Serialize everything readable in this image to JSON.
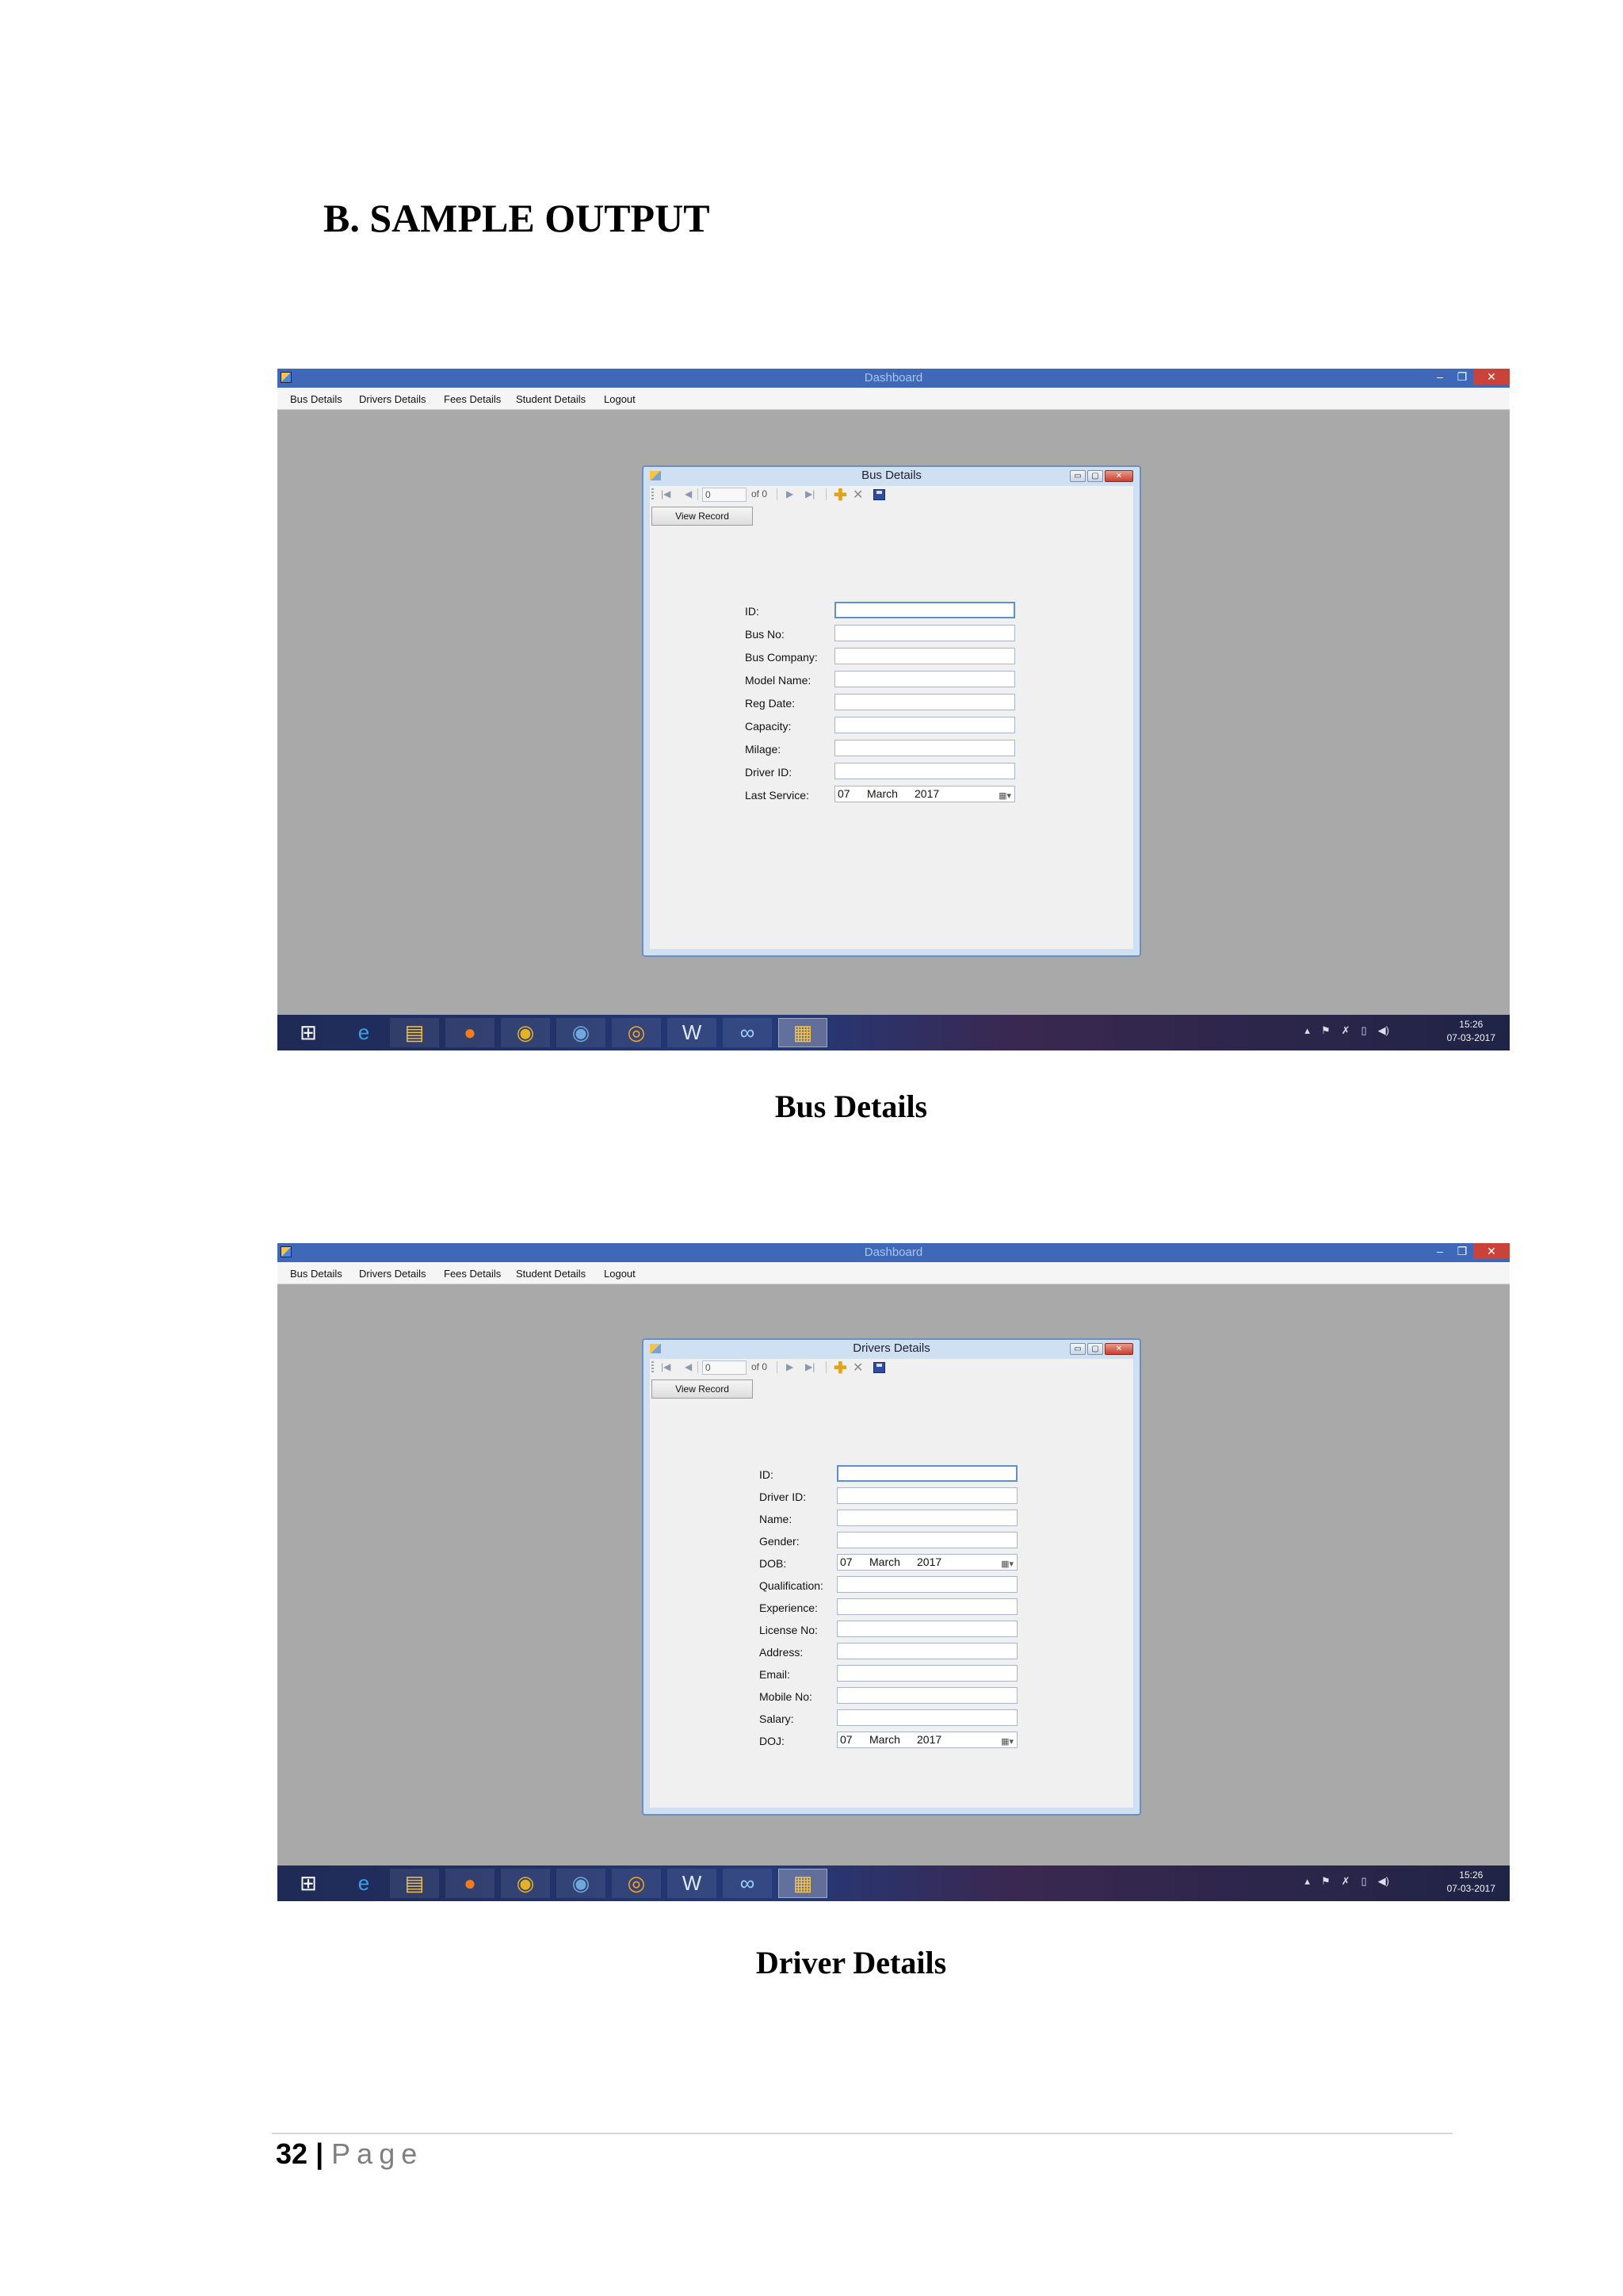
{
  "section_heading": "B. SAMPLE OUTPUT",
  "captions": {
    "bus": "Bus Details",
    "driver": "Driver Details"
  },
  "main_window": {
    "title": "Dashboard"
  },
  "menu": [
    "Bus Details",
    "Drivers Details",
    "Fees Details",
    "Student Details",
    "Logout"
  ],
  "navigator": {
    "position": "0",
    "count_label": "of 0"
  },
  "bus_form": {
    "title": "Bus Details",
    "view_button": "View Record",
    "labels": [
      "ID:",
      "Bus No:",
      "Bus Company:",
      "Model Name:",
      "Reg Date:",
      "Capacity:",
      "Milage:",
      "Driver ID:",
      "Last Service:"
    ],
    "last_service": {
      "day": "07",
      "month": "March",
      "year": "2017"
    }
  },
  "driver_form": {
    "title": "Drivers Details",
    "view_button": "View Record",
    "labels": [
      "ID:",
      "Driver ID:",
      "Name:",
      "Gender:",
      "DOB:",
      "Qualification:",
      "Experience:",
      "License No:",
      "Address:",
      "Email:",
      "Mobile No:",
      "Salary:",
      "DOJ:"
    ],
    "dob": {
      "day": "07",
      "month": "March",
      "year": "2017"
    },
    "doj": {
      "day": "07",
      "month": "March",
      "year": "2017"
    }
  },
  "taskbar": {
    "time": "15:26",
    "date": "07-03-2017"
  },
  "footer": {
    "page_number": "32",
    "separator": "|",
    "page_word": "Page"
  }
}
